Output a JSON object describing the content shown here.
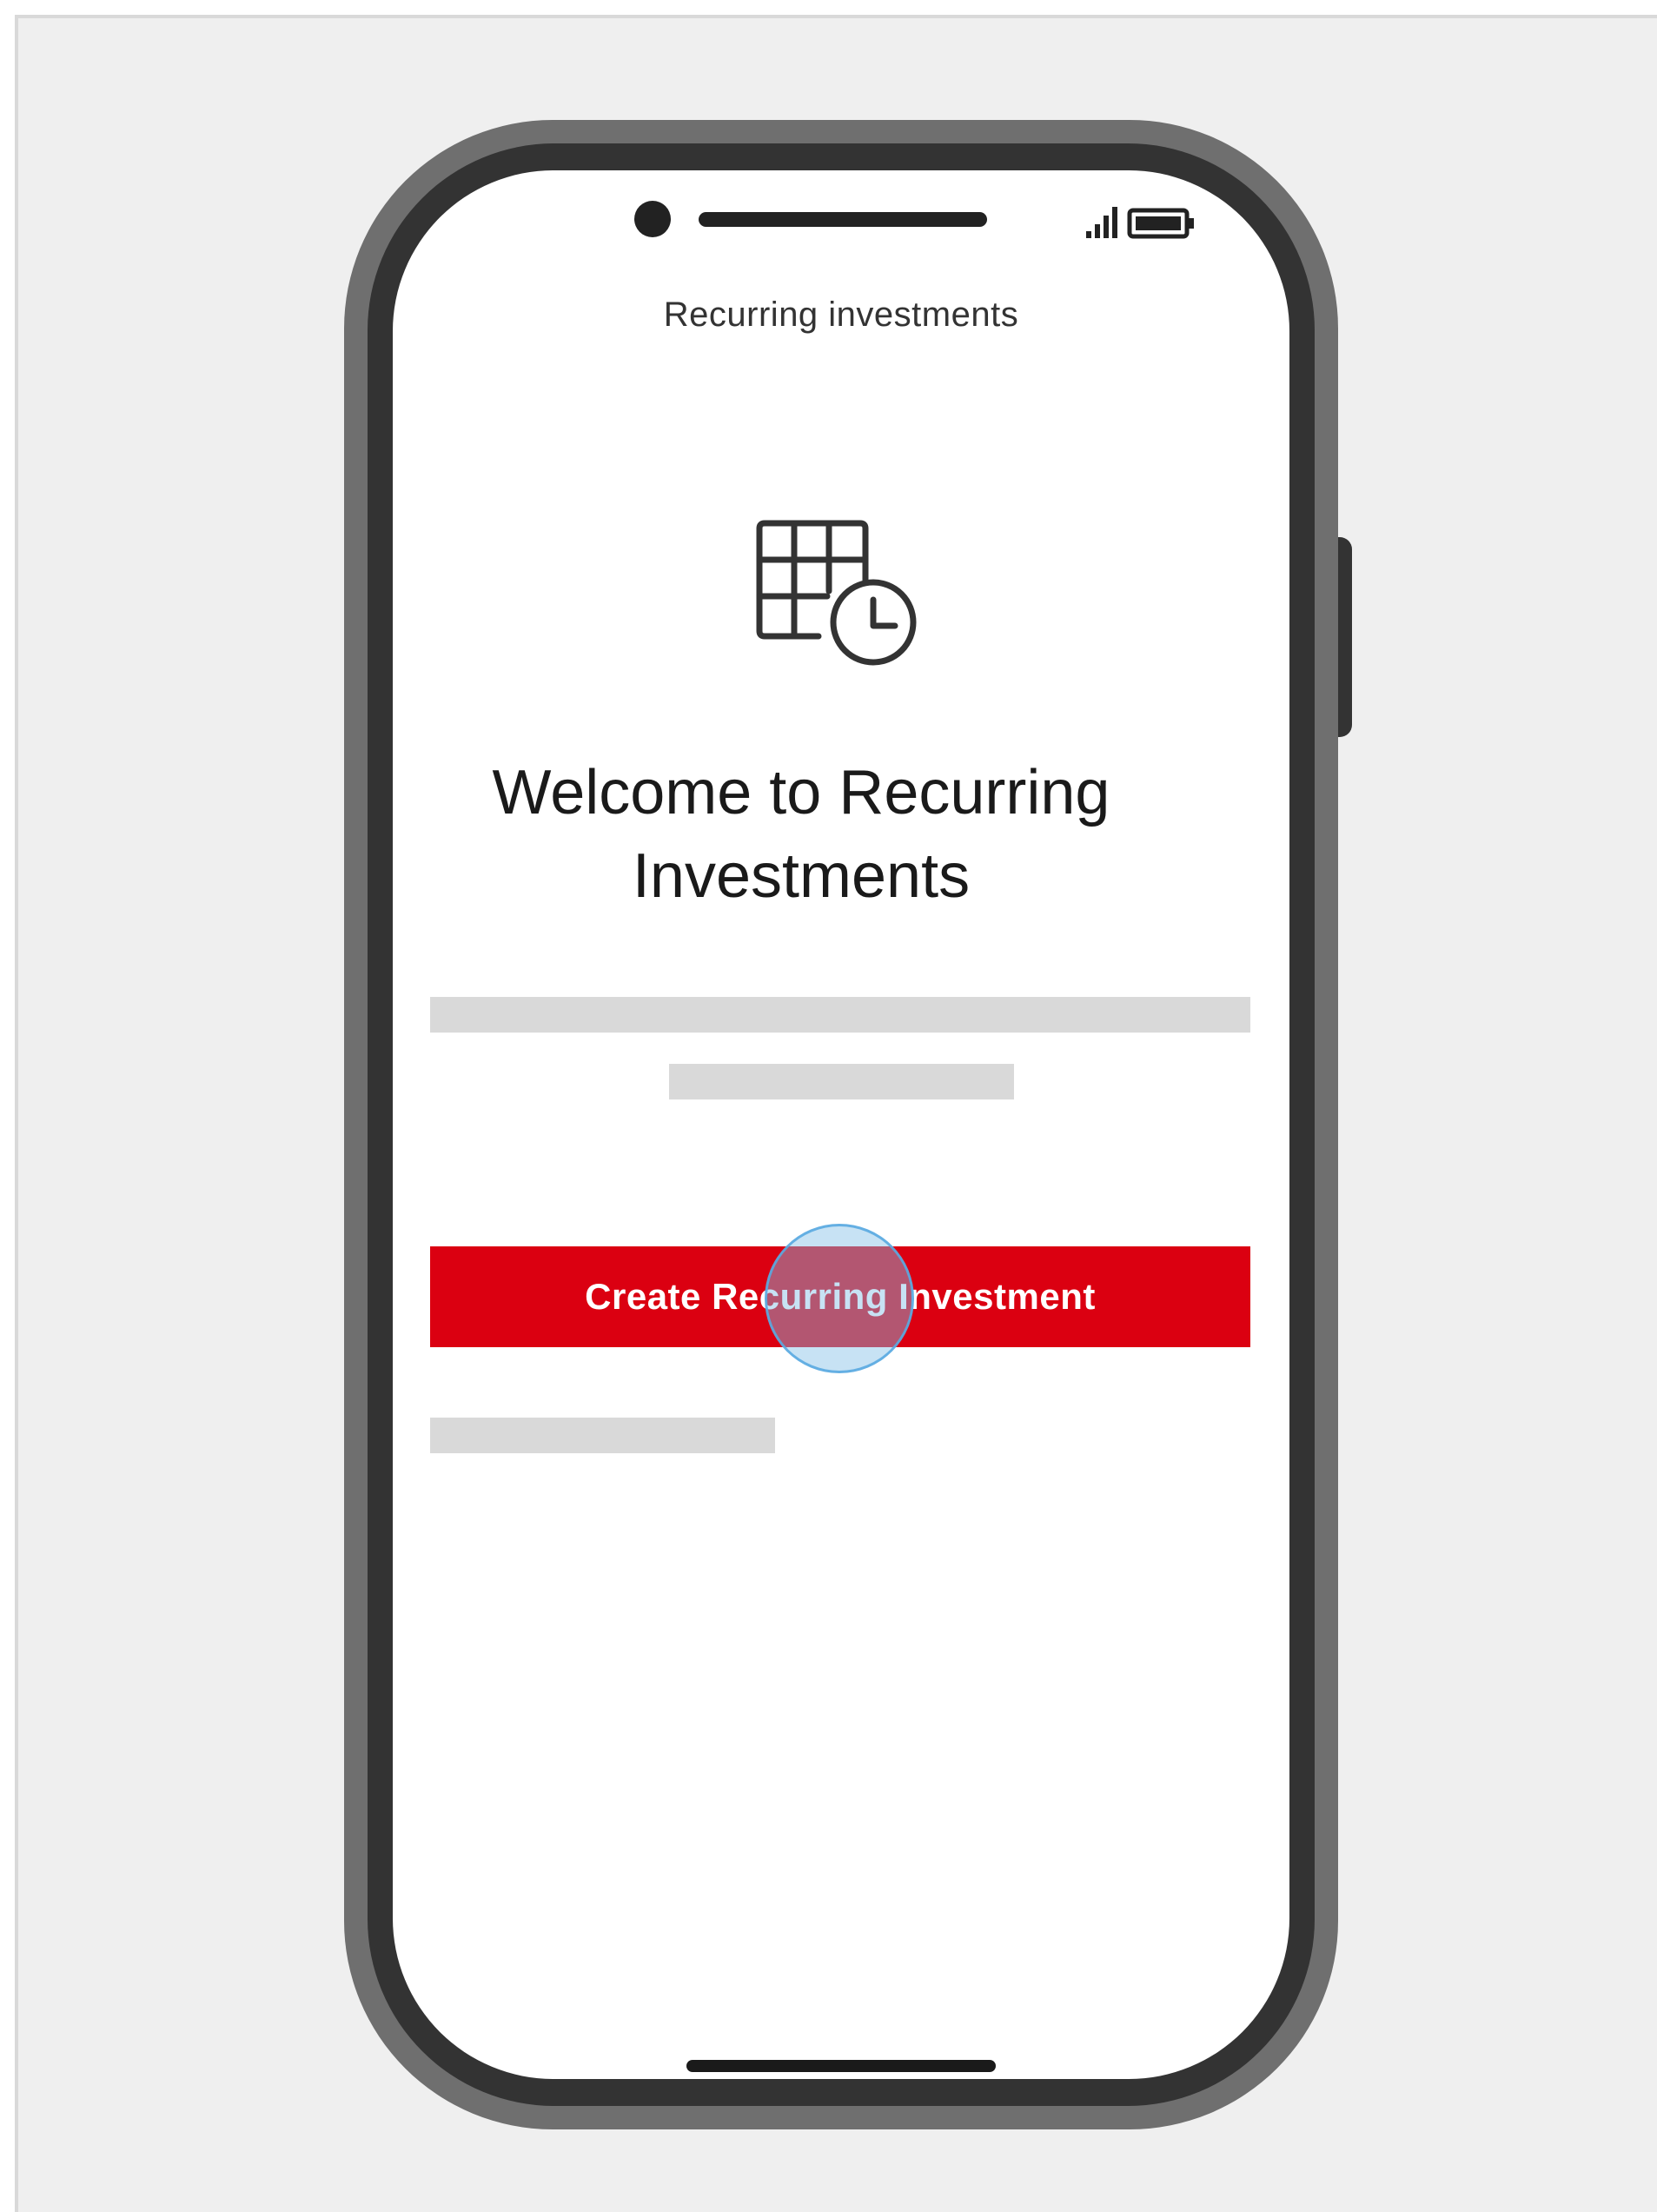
{
  "screen": {
    "title": "Recurring investments",
    "welcome_heading": "Welcome to Recurring Investments",
    "primary_button_label": "Create Recurring Investment",
    "hero_icon": "calendar-clock-icon",
    "status_icons": [
      "signal-icon",
      "battery-icon"
    ]
  },
  "colors": {
    "accent": "#db0011",
    "backdrop": "#efefef",
    "device_frame": "#333333",
    "placeholder": "#d9d9d9"
  }
}
